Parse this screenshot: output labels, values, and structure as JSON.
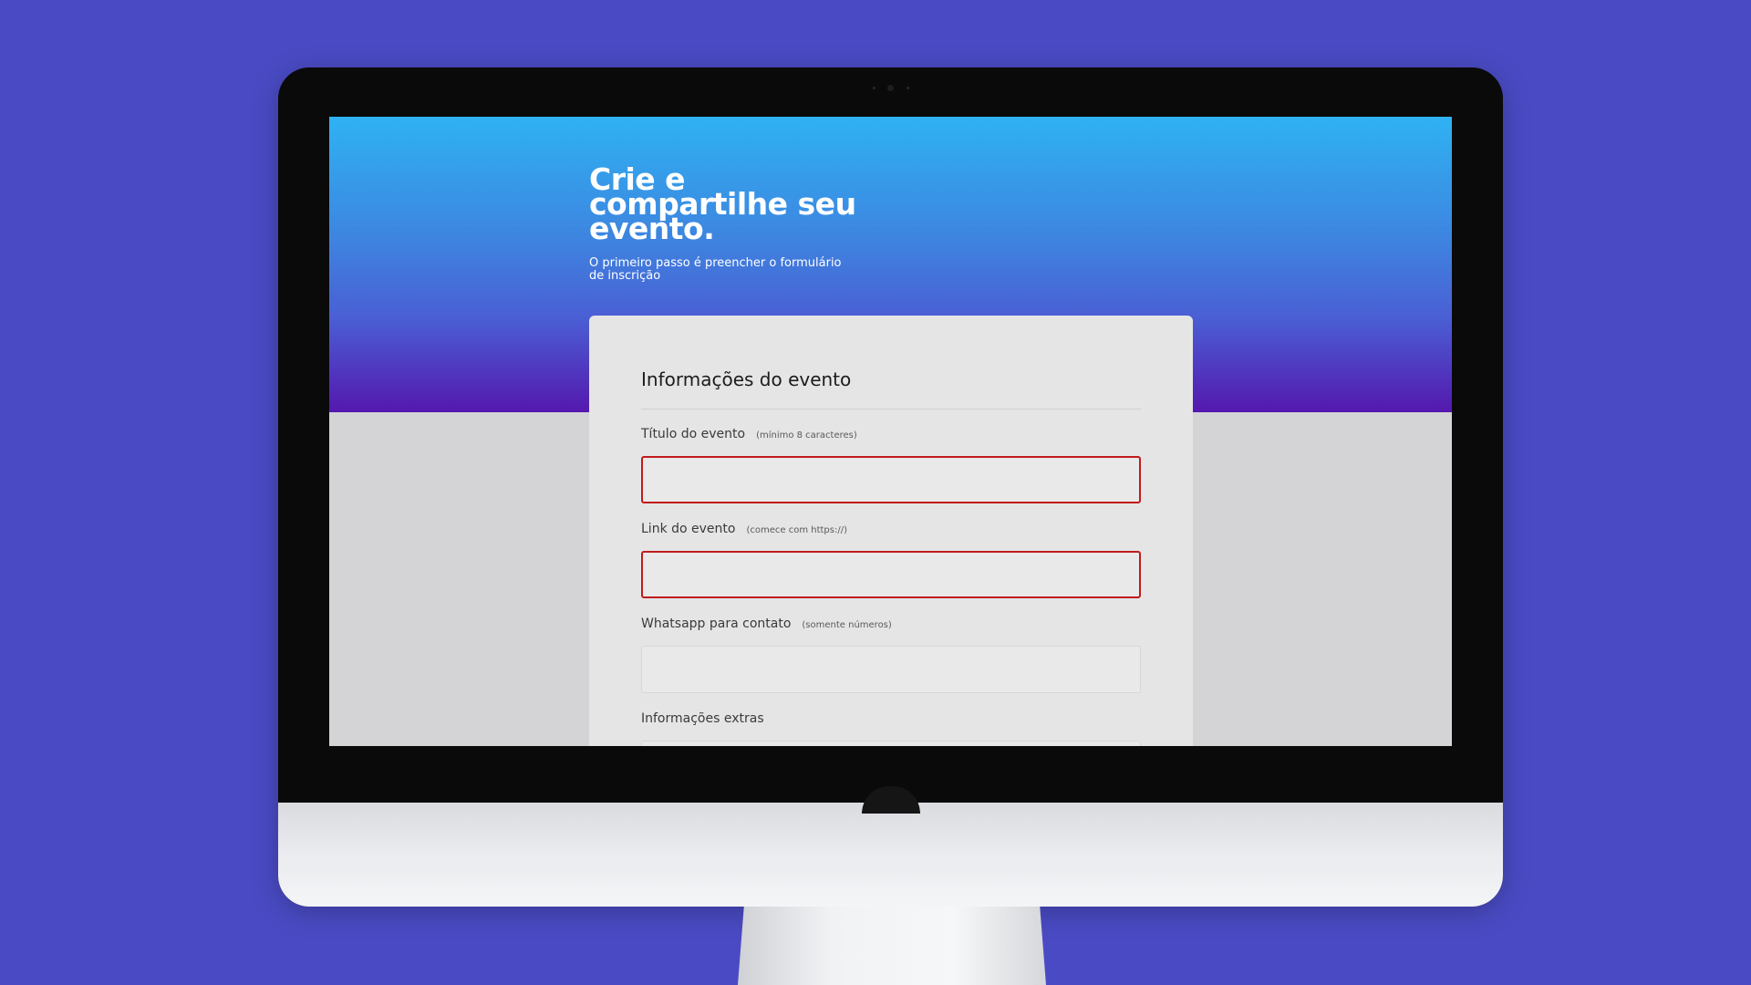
{
  "hero": {
    "title": "Crie e compartilhe seu evento.",
    "subtitle": "O primeiro passo é preencher o formulário de inscrição"
  },
  "form": {
    "title": "Informações do evento",
    "fields": [
      {
        "label": "Título do evento",
        "hint": "(mínimo 8 caracteres)",
        "value": "",
        "state": "error"
      },
      {
        "label": "Link do evento",
        "hint": "(comece com https://)",
        "value": "",
        "state": "error"
      },
      {
        "label": "Whatsapp para contato",
        "hint": "(somente números)",
        "value": "",
        "state": "normal"
      },
      {
        "label": "Informações extras",
        "hint": "",
        "value": "",
        "state": "normal"
      }
    ]
  },
  "colors": {
    "background": "#4a4bc4",
    "hero_top": "#2fb2f3",
    "hero_bottom": "#5418ae",
    "error_border": "#c11b1b"
  }
}
